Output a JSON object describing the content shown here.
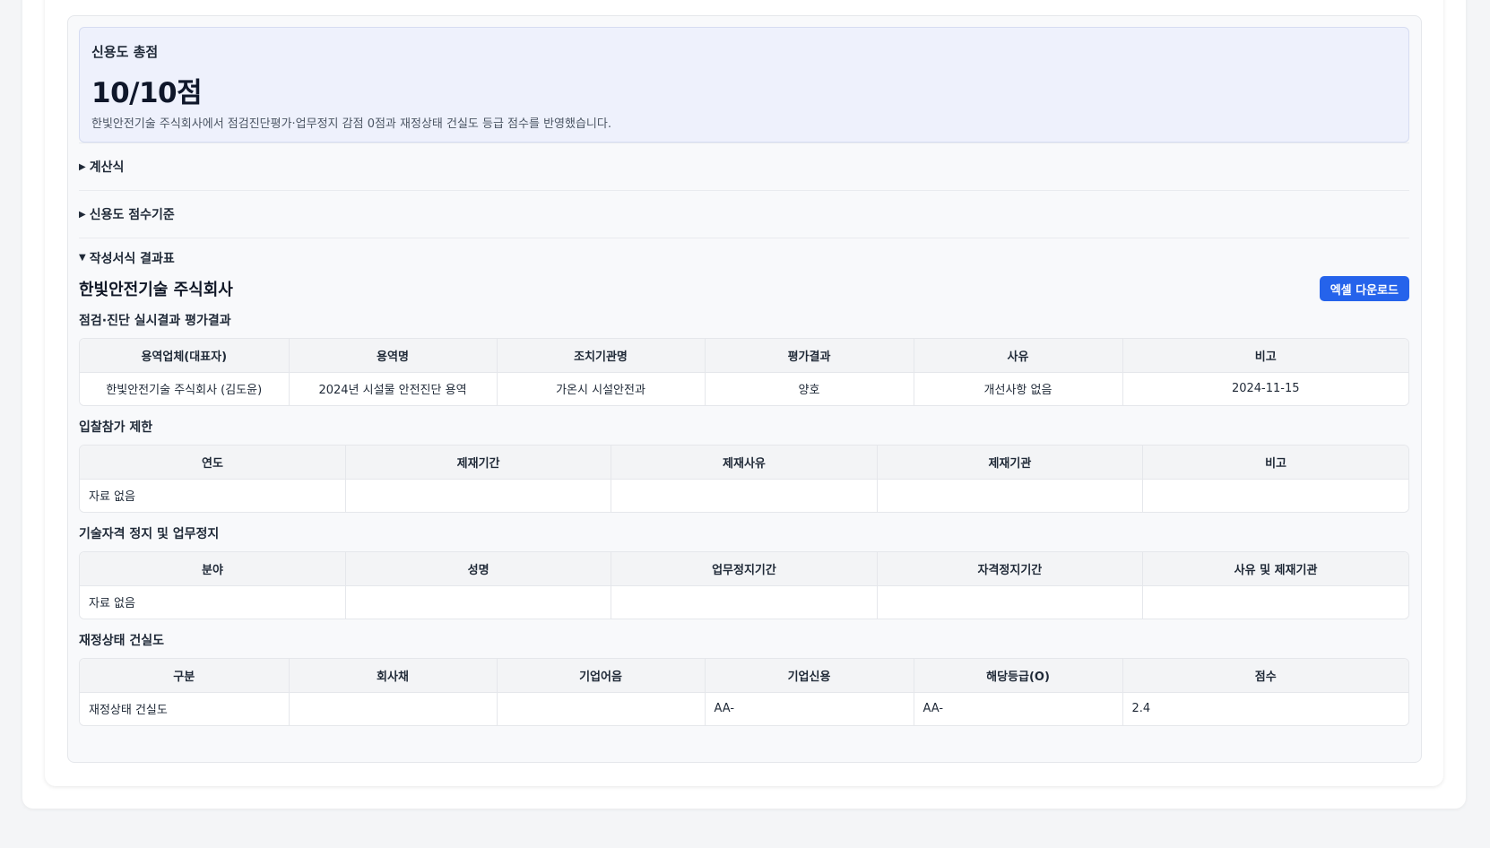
{
  "score": {
    "label": "신용도 총점",
    "value": "10/10점",
    "description": "한빛안전기술 주식회사에서 점검진단평가·업무정지 감점 0점과 재정상태 건실도 등급 점수를 반영했습니다."
  },
  "toggles": [
    {
      "icon": "▶",
      "label": "계산식"
    },
    {
      "icon": "▶",
      "label": "신용도 점수기준"
    },
    {
      "icon": "▼",
      "label": "작성서식 결과표"
    }
  ],
  "company": {
    "name": "한빛안전기술 주식회사",
    "excel_label": "엑셀 다운로드"
  },
  "inspection": {
    "title": "점검·진단 실시결과 평가결과",
    "headers": [
      "용역업체(대표자)",
      "용역명",
      "조치기관명",
      "평가결과",
      "사유",
      "비고"
    ],
    "row": [
      "한빛안전기술 주식회사 (김도윤)",
      "2024년 시설물 안전진단 용역",
      "가온시 시설안전과",
      "양호",
      "개선사항 없음",
      "2024-11-15"
    ]
  },
  "bid_restriction": {
    "title": "입찰참가 제한",
    "headers": [
      "연도",
      "제재기간",
      "제재사유",
      "제재기관",
      "비고"
    ],
    "empty": "자료 없음"
  },
  "qualification": {
    "title": "기술자격 정지 및 업무정지",
    "headers": [
      "분야",
      "성명",
      "업무정지기간",
      "자격정지기간",
      "사유 및 제재기관"
    ],
    "empty": "자료 없음"
  },
  "financial": {
    "title": "재정상태 건실도",
    "headers": [
      "구분",
      "회사채",
      "기업어음",
      "기업신용",
      "해당등급(O)",
      "점수"
    ],
    "row": [
      "재정상태 건실도",
      "",
      "",
      "AA-",
      "AA-",
      "2.4"
    ]
  }
}
